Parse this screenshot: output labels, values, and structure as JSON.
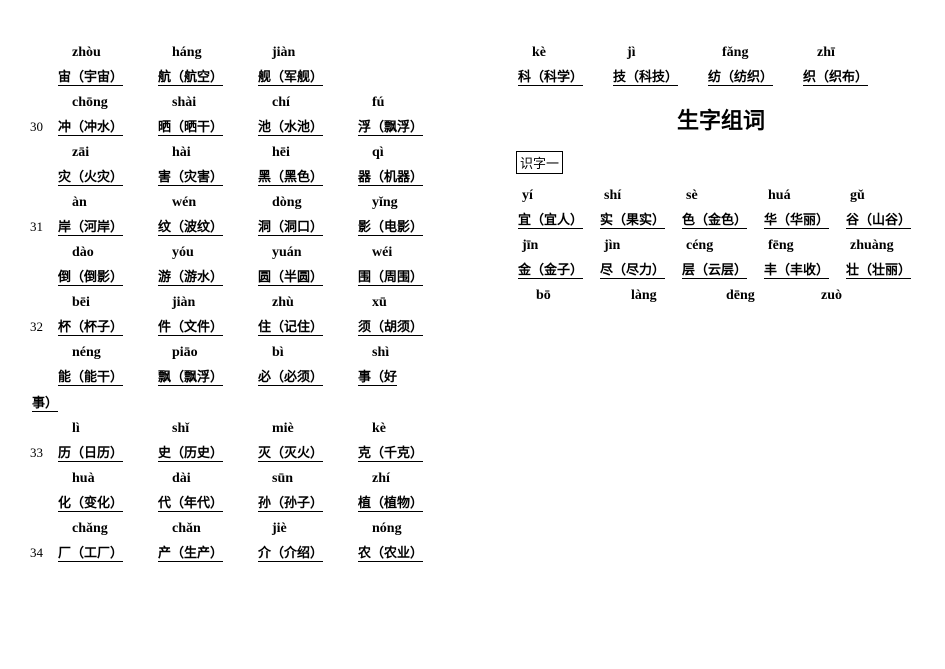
{
  "left": {
    "block1": {
      "pinyin": [
        "zhòu",
        "háng",
        "jiàn"
      ],
      "chars": [
        "宙（宇宙）",
        "航（航空）",
        "舰（军舰）"
      ],
      "num": ""
    },
    "block2": {
      "pinyin": [
        "chōng",
        "shài",
        "chí",
        "fú"
      ],
      "chars": [
        "冲（冲水）",
        "晒（晒干）",
        "池（水池）",
        "浮（飘浮）"
      ],
      "num": "30"
    },
    "block3": {
      "pinyin": [
        "zāi",
        "hài",
        "hēi",
        "qì"
      ],
      "chars": [
        "灾（火灾）",
        "害（灾害）",
        "黑（黑色）",
        "器（机器）"
      ],
      "num": ""
    },
    "block4": {
      "pinyin": [
        "àn",
        "wén",
        "dòng",
        "yǐng"
      ],
      "chars": [
        "岸（河岸）",
        "纹（波纹）",
        "洞（洞口）",
        "影（电影）"
      ],
      "num": "31"
    },
    "block5": {
      "pinyin": [
        "dào",
        "yóu",
        "yuán",
        "wéi"
      ],
      "chars": [
        "倒（倒影）",
        "游（游水）",
        "圆（半圆）",
        "围（周围）"
      ],
      "num": ""
    },
    "block6": {
      "pinyin": [
        "bēi",
        "jiàn",
        "zhù",
        "xū"
      ],
      "chars": [
        "杯（杯子）",
        "件（文件）",
        "住（记住）",
        "须（胡须）"
      ],
      "num": "32"
    },
    "block7": {
      "pinyin": [
        "néng",
        "piāo",
        "bì",
        "shì"
      ],
      "chars": [
        "能（能干）",
        "飘（飘浮）",
        "必（必须）",
        "事（好"
      ],
      "num": "",
      "wrap": "事）"
    },
    "block8": {
      "pinyin": [
        "lì",
        "shǐ",
        "miè",
        "kè"
      ],
      "chars": [
        "历（日历）",
        "史（历史）",
        "灭（灭火）",
        "克（千克）"
      ],
      "num": "33"
    },
    "block9": {
      "pinyin": [
        "huà",
        "dài",
        "sūn",
        "zhí"
      ],
      "chars": [
        "化（变化）",
        "代（年代）",
        "孙（孙子）",
        "植（植物）"
      ],
      "num": ""
    },
    "block10": {
      "pinyin": [
        "chǎng",
        "chǎn",
        "jiè",
        "nóng"
      ],
      "chars": [
        "厂（工厂）",
        "产（生产）",
        "介（介绍）",
        "农（农业）"
      ],
      "num": "34"
    }
  },
  "right": {
    "top": {
      "pinyin": [
        "kè",
        "jì",
        "fǎng",
        "zhī"
      ],
      "chars": [
        "科（科学）",
        "技（科技）",
        "纺（纺织）",
        "织（织布）"
      ]
    },
    "title": "生字组词",
    "sectionLabel": "识字一",
    "r1": {
      "pinyin": [
        "yí",
        "shí",
        "sè",
        "huá",
        "gǔ"
      ],
      "chars": [
        "宜（宜人）",
        "实（果实）",
        "色（金色）",
        "华（华丽）",
        "谷（山谷）"
      ]
    },
    "r2": {
      "pinyin": [
        "jīn",
        "jìn",
        "céng",
        "fēng",
        "zhuàng"
      ],
      "chars": [
        "金（金子）",
        "尽（尽力）",
        "层（云层）",
        "丰（丰收）",
        "壮（壮丽）"
      ]
    },
    "r3": {
      "pinyin": [
        "bō",
        "làng",
        "dēng",
        "zuò"
      ],
      "chars": [
        "",
        "",
        "",
        ""
      ]
    }
  }
}
